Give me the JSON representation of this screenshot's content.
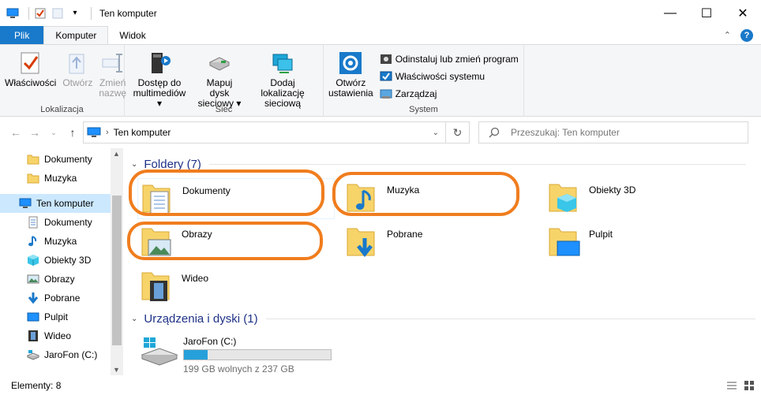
{
  "window": {
    "title": "Ten komputer",
    "controls": {
      "minimize": "—",
      "maximize": "☐",
      "close": "✕"
    }
  },
  "quick_access": {
    "icons": [
      "computer-icon",
      "properties-checkbox-icon",
      "new-folder-icon",
      "customize-dropdown-icon"
    ]
  },
  "ribbon_tabs": {
    "file": "Plik",
    "computer": "Komputer",
    "view": "Widok",
    "active": "Komputer"
  },
  "ribbon": {
    "lokalizacja": {
      "label": "Lokalizacja",
      "properties": "Właściwości",
      "open": "Otwórz",
      "rename_line1": "Zmień",
      "rename_line2": "nazwę"
    },
    "siec": {
      "label": "Sieć",
      "media_line1": "Dostęp do",
      "media_line2": "multimediów",
      "map_line1": "Mapuj dysk",
      "map_line2": "sieciowy",
      "add_line1": "Dodaj lokalizację",
      "add_line2": "sieciową"
    },
    "system": {
      "label": "System",
      "settings_line1": "Otwórz",
      "settings_line2": "ustawienia",
      "uninstall": "Odinstaluj lub zmień program",
      "sysprops": "Właściwości systemu",
      "manage": "Zarządzaj"
    }
  },
  "address": {
    "path": "Ten komputer",
    "search_placeholder": "Przeszukaj: Ten komputer"
  },
  "nav_pane": {
    "items": [
      {
        "label": "Dokumenty",
        "icon": "folder-icon"
      },
      {
        "label": "Muzyka",
        "icon": "folder-icon"
      },
      {
        "label": "Ten komputer",
        "icon": "computer-icon",
        "selected": true
      },
      {
        "label": "Dokumenty",
        "icon": "documents-icon"
      },
      {
        "label": "Muzyka",
        "icon": "music-icon"
      },
      {
        "label": "Obiekty 3D",
        "icon": "cube-icon"
      },
      {
        "label": "Obrazy",
        "icon": "pictures-icon"
      },
      {
        "label": "Pobrane",
        "icon": "download-icon"
      },
      {
        "label": "Pulpit",
        "icon": "desktop-icon"
      },
      {
        "label": "Wideo",
        "icon": "video-icon"
      },
      {
        "label": "JaroFon (C:)",
        "icon": "drive-icon"
      }
    ]
  },
  "content": {
    "folders_header": "Foldery (7)",
    "folders": [
      {
        "label": "Dokumenty",
        "icon": "documents-folder-icon"
      },
      {
        "label": "Muzyka",
        "icon": "music-folder-icon"
      },
      {
        "label": "Obiekty 3D",
        "icon": "3d-objects-folder-icon"
      },
      {
        "label": "Obrazy",
        "icon": "pictures-folder-icon"
      },
      {
        "label": "Pobrane",
        "icon": "downloads-folder-icon"
      },
      {
        "label": "Pulpit",
        "icon": "desktop-folder-icon"
      },
      {
        "label": "Wideo",
        "icon": "videos-folder-icon"
      }
    ],
    "devices_header": "Urządzenia i dyski (1)",
    "drive": {
      "name": "JaroFon (C:)",
      "free_text": "199 GB wolnych z 237 GB",
      "used_fraction": 0.16
    }
  },
  "status": {
    "items": "Elementy: 8"
  },
  "colors": {
    "accent": "#1979ca",
    "header": "#1e3287",
    "selection": "#cce8ff",
    "annotation": "#f07d1e",
    "drive_bar": "#26a0da"
  }
}
